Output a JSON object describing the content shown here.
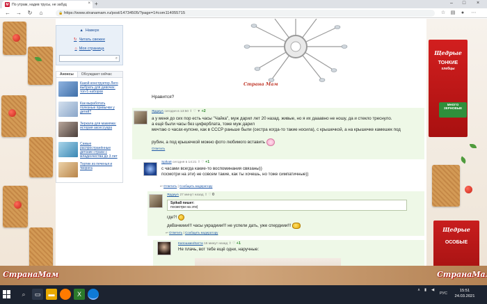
{
  "browser": {
    "tab_title": "По утрам, надев трусы, не забуд",
    "url": "https://www.stranamam.ru/post/14734505/?page=1#com114055715",
    "favicon_letter": "М"
  },
  "sidebar": {
    "nav": [
      {
        "label": "Наверх",
        "icon": "arrow-up-icon"
      },
      {
        "label": "Читать свежее",
        "icon": "refresh-icon"
      },
      {
        "label": "Моя страница",
        "icon": "home-icon"
      }
    ],
    "tabs": [
      "Анонсы",
      "Обсуждают сейчас"
    ],
    "announcements": [
      {
        "text": "Какой конструктор Лего выбрать для девочек: топ-5 наборов",
        "color": "#6a93c9"
      },
      {
        "text": "Как выработать полезные привычки у детей?",
        "color": "#9fb7d6"
      },
      {
        "text": "Зеркала для макияжа: история аксессуара",
        "color": "#7c6f68"
      },
      {
        "text": "Самые распространённые детские страхи с младенчества до 3 лет",
        "color": "#73b0d1"
      },
      {
        "text": "Тортик из печенья и творога",
        "color": "#c9a272"
      }
    ]
  },
  "post": {
    "signature": "Страна Мам",
    "question": "Нравится?"
  },
  "comments": [
    {
      "author": "ЯрдиуА",
      "time": "сегодня в 13:50",
      "rating": "+2",
      "lines": [
        "а у меня до сих пор есть часы \"Чайка\", муж дарил лет 20 назад. живые, но я их дааавно не ношу, да и стекло треснуло.",
        "а ещё были часы без циферблата, тоже муж дарил",
        "мечтаю о часах-кулоне, как в СССР раньше были (сестра когда-то такие носила), с крышечкой, а на крышечке камешек под",
        "рубин, а под крышечкой можно фото любимого вставить"
      ],
      "actions": [
        "Ответить",
        "Сообщить модератору"
      ],
      "reply_label": "Ответить"
    },
    {
      "author": "Spika8",
      "time": "сегодня в 14:21",
      "rating": "+1",
      "lines": [
        "с часами всегда какие-то воспоминания связаны))",
        "посмотри на эти) не совсем такие, как ты хочешь, но тоже симпатичные))"
      ],
      "actions": [
        "Ответить",
        "Сообщить модератору"
      ]
    },
    {
      "author": "ЯрдиуА",
      "time": "27 минут назад",
      "rating": "0",
      "quote_author": "Spika8 пишет:",
      "quote_text": "посмотри на эти)",
      "lines": [
        "где?!",
        "деВачкиии!!! часы украдиии!!! не успели дать, уже спердиии!!!"
      ],
      "actions": [
        "Ответить",
        "Сообщить модератору"
      ]
    },
    {
      "author": "Капошкин/Катти",
      "time": "16 минут назад",
      "rating": "+1",
      "lines": [
        "Не плачь, вот тебе ещё одни, наручные:"
      ]
    }
  ],
  "ads": {
    "brand": "Щедрые",
    "kind": "ТОНКИЕ",
    "kind_sub": "хлебцы",
    "badge": "МНОГО ЗЕРНОВЫЕ",
    "kind2": "ОСОБЫЕ",
    "logo": "СтранаМам"
  },
  "taskbar": {
    "time": "15:51",
    "date": "24.03.2021",
    "lang": "РУС"
  }
}
